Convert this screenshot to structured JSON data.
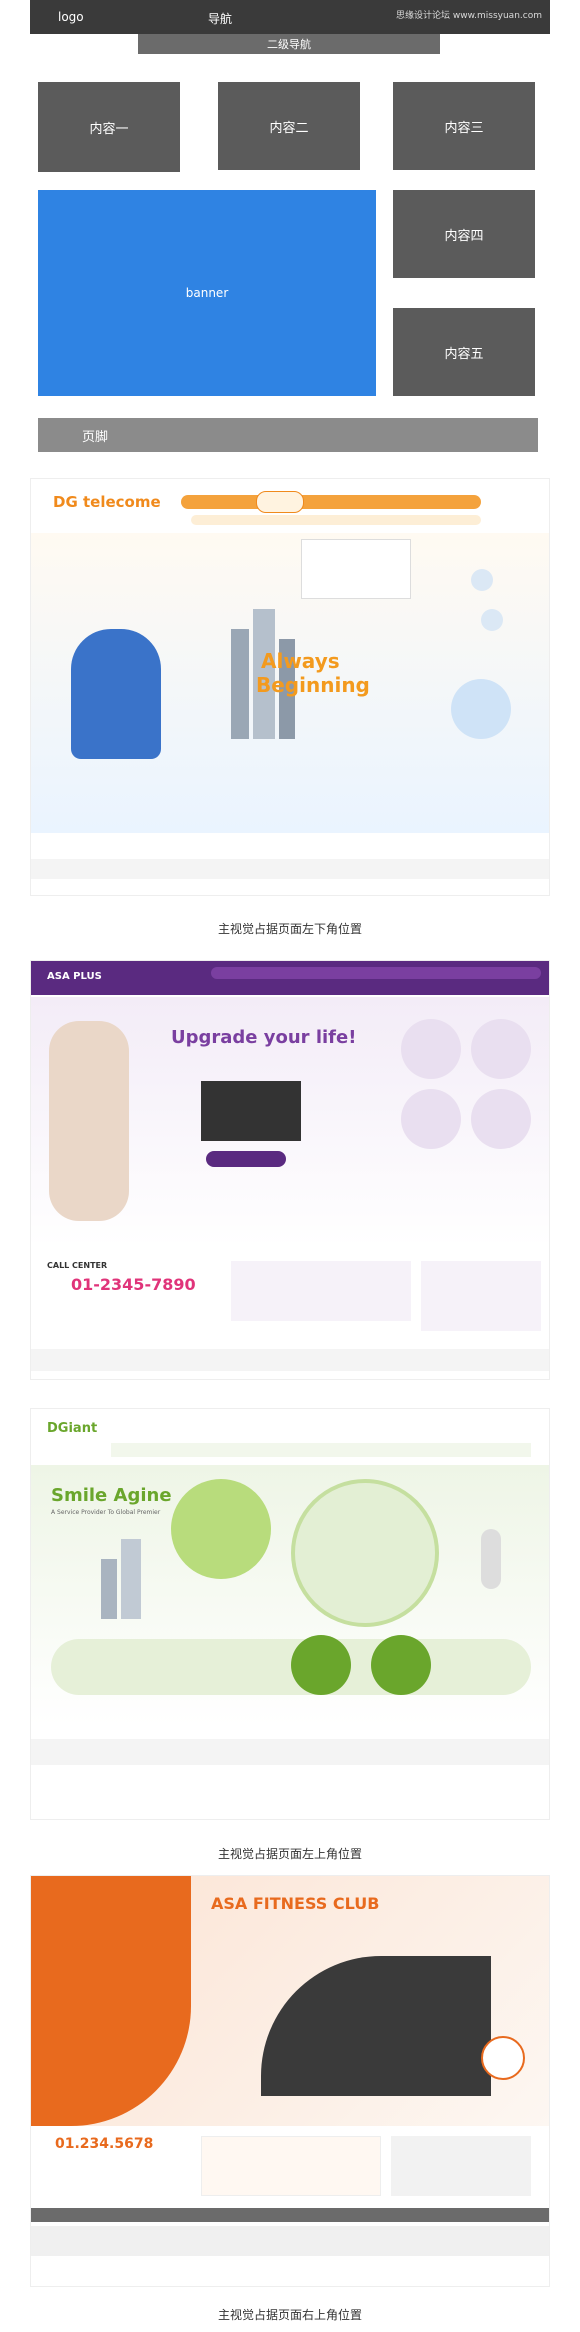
{
  "wireframe": {
    "logo": "logo",
    "nav": "导航",
    "watermark": "思缘设计论坛 www.missyuan.com",
    "subnav": "二级导航",
    "content1": "内容一",
    "content2": "内容二",
    "content3": "内容三",
    "content4": "内容四",
    "content5": "内容五",
    "banner": "banner",
    "footer": "页脚"
  },
  "examples": [
    {
      "caption": "主视觉占据页面左下角位置",
      "brand": "DG telecome",
      "headline1": "Always",
      "headline2": "Beginning",
      "accent": "#f08a1c"
    },
    {
      "caption": "",
      "brand": "ASA PLUS",
      "headline": "Upgrade your life!",
      "phone": "01-2345-7890",
      "call_label": "CALL CENTER",
      "accent": "#7a3fa0"
    },
    {
      "caption": "主视觉占据页面左上角位置",
      "brand": "DGiant",
      "headline1": "Smile Agine",
      "headline2": "A Service Provider To Global Premier",
      "accent": "#6aa62c"
    },
    {
      "caption": "主视觉占据页面右上角位置",
      "brand": "ASA FITNESS CLUB",
      "phone": "01.234.5678",
      "accent": "#e86a1e"
    }
  ]
}
